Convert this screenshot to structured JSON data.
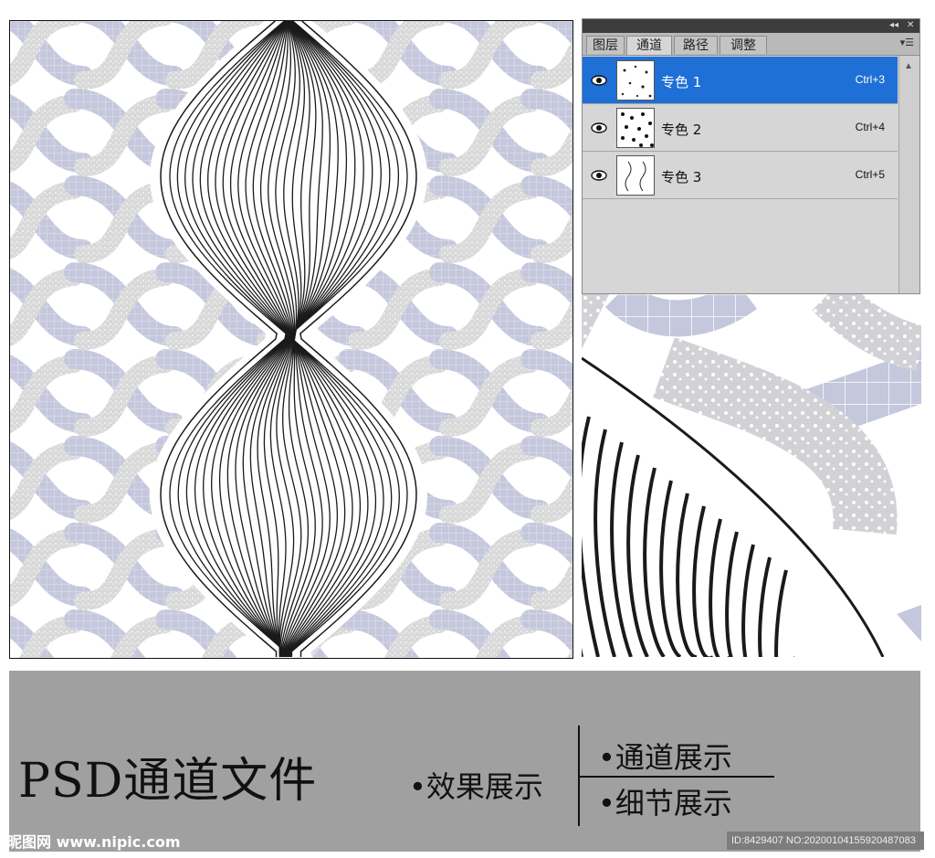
{
  "colors": {
    "pattern_lavender": "#c5c7dc",
    "speckle_gray": "#d9d9d9",
    "line_black": "#1a1a1a",
    "selection_blue": "#1e6fd6",
    "banner_gray": "#a0a0a0"
  },
  "channels_panel": {
    "tabs": [
      {
        "label": "图层"
      },
      {
        "label": "通道"
      },
      {
        "label": "路径"
      },
      {
        "label": "调整"
      }
    ],
    "active_tab": "通道",
    "channels": [
      {
        "name": "专色 1",
        "shortcut": "Ctrl+3",
        "selected": true
      },
      {
        "name": "专色 2",
        "shortcut": "Ctrl+4",
        "selected": false
      },
      {
        "name": "专色 3",
        "shortcut": "Ctrl+5",
        "selected": false
      }
    ],
    "icons": [
      "collapse-icon",
      "close-icon",
      "panel-menu-icon",
      "eye-icon",
      "scroll-up-icon"
    ]
  },
  "banner": {
    "title": "PSD通道文件",
    "effect_label": "•效果展示",
    "channel_label": "•通道展示",
    "detail_label": "•细节展示"
  },
  "watermark": {
    "logo": "昵图网 www.nipic.com",
    "id_text": "ID:8429407 NO:20200104155920487083"
  }
}
